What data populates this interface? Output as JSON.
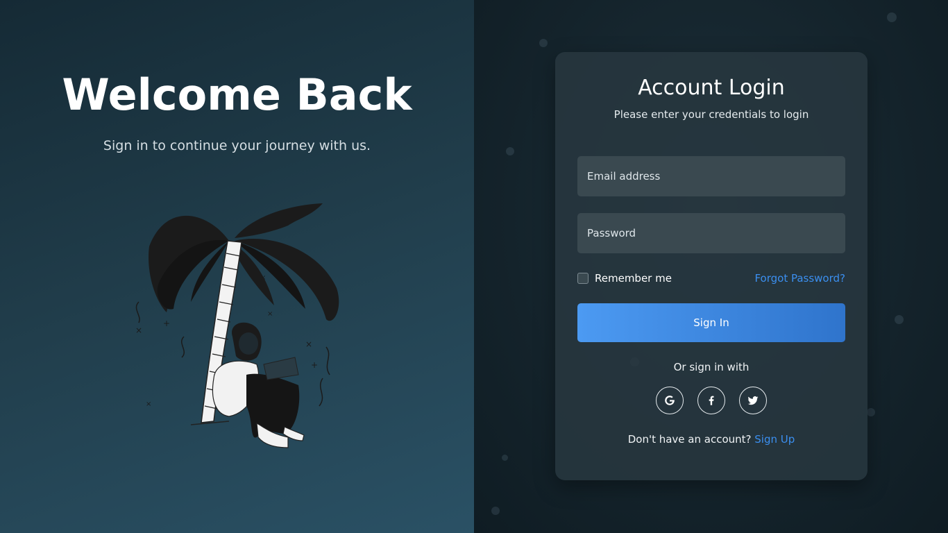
{
  "hero": {
    "title": "Welcome Back",
    "subtitle": "Sign in to continue your journey with us."
  },
  "card": {
    "title": "Account Login",
    "subtitle": "Please enter your credentials to login",
    "email_placeholder": "Email address",
    "password_placeholder": "Password",
    "remember_label": "Remember me",
    "forgot_label": "Forgot Password?",
    "signin_label": "Sign In",
    "or_label": "Or sign in with",
    "socials": [
      "google-icon",
      "facebook-icon",
      "twitter-icon"
    ],
    "signup_prompt": "Don't have an account?",
    "signup_label": "Sign Up"
  },
  "colors": {
    "accent": "#3b8ff0",
    "button_start": "#4c9af2",
    "button_end": "#2f74cc",
    "left_bg": "#213e4c",
    "right_bg": "#14232b"
  }
}
